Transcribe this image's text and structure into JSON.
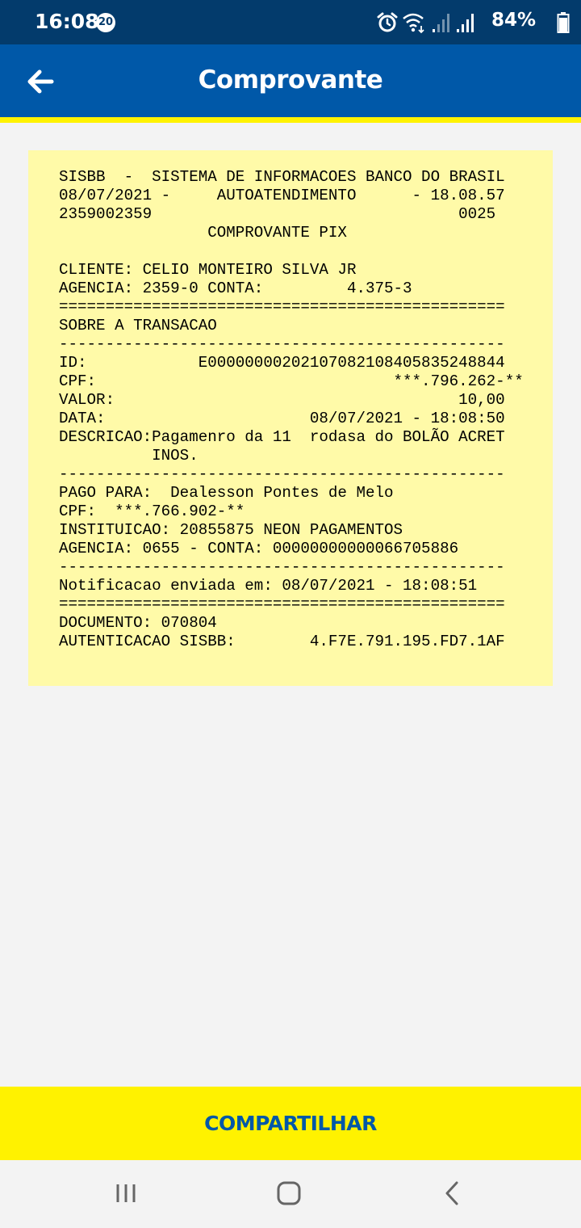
{
  "status_bar": {
    "time": "16:08",
    "notification_count": "20",
    "battery": "84%",
    "icons": [
      "alarm-icon",
      "wifi-icon",
      "signal-icon",
      "signal-icon",
      "battery-icon"
    ]
  },
  "header": {
    "title": "Comprovante",
    "back_icon": "arrow-left-icon"
  },
  "receipt": {
    "lines": [
      "SISBB  -  SISTEMA DE INFORMACOES BANCO DO BRASIL",
      "08/07/2021 -     AUTOATENDIMENTO      - 18.08.57",
      "2359002359                                 0025",
      "                COMPROVANTE PIX",
      "",
      "CLIENTE: CELIO MONTEIRO SILVA JR",
      "AGENCIA: 2359-0 CONTA:         4.375-3",
      "================================================",
      "SOBRE A TRANSACAO",
      "------------------------------------------------",
      "ID:            E00000000202107082108405835248844",
      "CPF:                                ***.796.262-**",
      "VALOR:                                     10,00",
      "DATA:                      08/07/2021 - 18:08:50",
      "DESCRICAO:Pagamenro da 11  rodasa do BOLÃO ACRET",
      "          INOS.",
      "------------------------------------------------",
      "PAGO PARA:  Dealesson Pontes de Melo",
      "CPF:  ***.766.902-**",
      "INSTITUICAO: 20855875 NEON PAGAMENTOS",
      "AGENCIA: 0655 - CONTA: 00000000000066705886",
      "------------------------------------------------",
      "Notificacao enviada em: 08/07/2021 - 18:08:51",
      "================================================",
      "DOCUMENTO: 070804",
      "AUTENTICACAO SISBB:        4.F7E.791.195.FD7.1AF"
    ]
  },
  "actions": {
    "share_label": "COMPARTILHAR"
  },
  "nav_bar": {
    "icons": [
      "recent-apps-icon",
      "home-icon",
      "back-icon"
    ]
  },
  "colors": {
    "status_bar": "#033b6c",
    "app_bar": "#0058a8",
    "accent_yellow": "#fff200",
    "receipt_bg": "#fffaa8",
    "background": "#f3f3f3"
  }
}
